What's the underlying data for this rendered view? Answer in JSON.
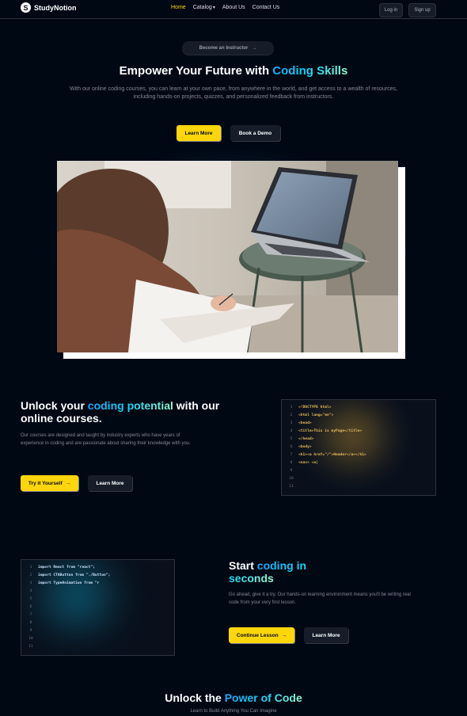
{
  "nav": {
    "logo_glyph": "S",
    "brand": "StudyNotion",
    "links": [
      {
        "label": "Home",
        "active": true
      },
      {
        "label": "Catalog",
        "has_dropdown": true
      },
      {
        "label": "About Us"
      },
      {
        "label": "Contact Us"
      }
    ],
    "login_label": "Log in",
    "signup_label": "Sign up",
    "caret": "▾"
  },
  "hero": {
    "instructor_label": "Become an Instructor",
    "arrow": "→",
    "title_plain": "Empower Your Future with ",
    "title_highlight": "Coding Skills",
    "subtitle": "With our online coding courses, you can learn at your own pace, from anywhere in the world, and get access to a wealth of resources, including hands-on projects, quizzes, and personalized feedback from instructors.",
    "learn_more_label": "Learn More",
    "book_demo_label": "Book a Demo"
  },
  "section1": {
    "title_a": "Unlock your ",
    "title_highlight": "coding potential",
    "title_b": " with our online courses.",
    "text": "Our courses are designed and taught by industry experts who have years of experience in coding and are passionate about sharing their knowledge with you.",
    "primary_label": "Try it Yourself",
    "secondary_label": "Learn More",
    "line_numbers": [
      "1",
      "2",
      "3",
      "4",
      "5",
      "6",
      "7",
      "8",
      "9",
      "10",
      "11"
    ],
    "code_lines": [
      "<!DOCTYPE html>",
      "<html lang=\"en\">",
      "<head>",
      "<title>This is myPage</title>",
      "</head>",
      "<body>",
      "<h1><a href=\"/\">Header</a></h1>",
      "<nav> <a|"
    ]
  },
  "section2": {
    "title_a": "Start ",
    "title_highlight": "coding in seconds",
    "text": "Go ahead, give it a try. Our hands-on learning environment means you'll be writing real code from your very first lesson.",
    "primary_label": "Continue Lesson",
    "secondary_label": "Learn More",
    "line_numbers": [
      "1",
      "2",
      "3",
      "4",
      "5",
      "6",
      "7",
      "8",
      "9",
      "10",
      "11"
    ],
    "code_lines": [
      "import React from \"react\";",
      "import CTAButton from \"./Button\";",
      "import TypeAnimation from \"r"
    ]
  },
  "bottom": {
    "title_plain": "Unlock the ",
    "title_highlight": "Power of Code",
    "subtitle": "Learn to Build Anything You Can Imagine"
  },
  "colors": {
    "background": "#000814",
    "accent_yellow": "#FFD60A",
    "code_yellow": "#E7BC5B",
    "code_blue": "#CFE5FF",
    "highlight_blue": "#12D8FA"
  }
}
